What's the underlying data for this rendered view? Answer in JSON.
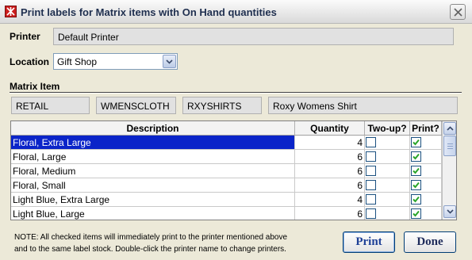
{
  "window": {
    "title": "Print labels for Matrix items with On Hand quantities"
  },
  "printer": {
    "label": "Printer",
    "value": "Default Printer"
  },
  "location": {
    "label": "Location",
    "value": "Gift Shop"
  },
  "matrix": {
    "label": "Matrix Item",
    "department": "RETAIL",
    "category": "WMENSCLOTH",
    "item_code": "RXYSHIRTS",
    "description": "Roxy Womens Shirt"
  },
  "table": {
    "columns": [
      "Description",
      "Quantity",
      "Two-up?",
      "Print?"
    ],
    "rows": [
      {
        "description": "Floral, Extra Large",
        "quantity": "4",
        "two_up": false,
        "print": true,
        "selected": true
      },
      {
        "description": "Floral, Large",
        "quantity": "6",
        "two_up": false,
        "print": true,
        "selected": false
      },
      {
        "description": "Floral, Medium",
        "quantity": "6",
        "two_up": false,
        "print": true,
        "selected": false
      },
      {
        "description": "Floral, Small",
        "quantity": "6",
        "two_up": false,
        "print": true,
        "selected": false
      },
      {
        "description": "Light Blue, Extra Large",
        "quantity": "4",
        "two_up": false,
        "print": true,
        "selected": false
      },
      {
        "description": "Light Blue, Large",
        "quantity": "6",
        "two_up": false,
        "print": true,
        "selected": false
      }
    ]
  },
  "note": {
    "line1": "NOTE:  All checked items will immediately print to the printer mentioned above",
    "line2": "and to the same label stock.  Double-click the printer name to change printers."
  },
  "buttons": {
    "print": "Print",
    "done": "Done"
  },
  "colors": {
    "selection": "#0a24c9",
    "check": "#2aa52a",
    "accent": "#003c74"
  }
}
